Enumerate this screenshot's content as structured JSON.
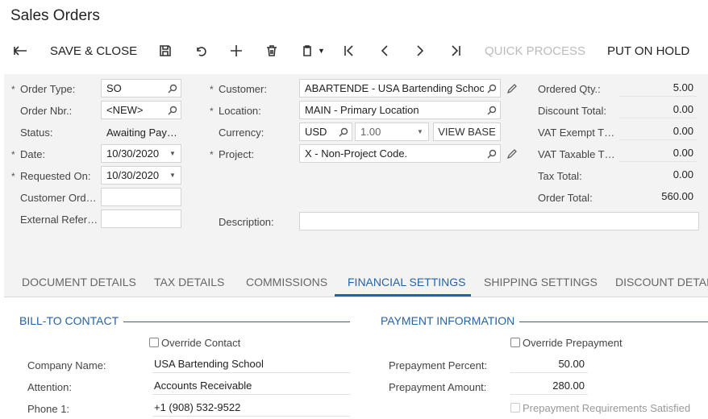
{
  "page": {
    "title": "Sales Orders"
  },
  "toolbar": {
    "back_icon": "back-arrow-icon",
    "save_close_label": "SAVE & CLOSE",
    "quick_process_label": "QUICK PROCESS",
    "put_on_hold_label": "PUT ON HOLD"
  },
  "form": {
    "order_type": {
      "label": "Order Type:",
      "value": "SO"
    },
    "order_nbr": {
      "label": "Order Nbr.:",
      "value": "<NEW>"
    },
    "status": {
      "label": "Status:",
      "value": "Awaiting Pay…"
    },
    "date": {
      "label": "Date:",
      "value": "10/30/2020"
    },
    "requested_on": {
      "label": "Requested On:",
      "value": "10/30/2020"
    },
    "customer_ord": {
      "label": "Customer Ord…",
      "value": ""
    },
    "external_ref": {
      "label": "External Refer…",
      "value": ""
    },
    "customer": {
      "label": "Customer:",
      "value": "ABARTENDE - USA Bartending Schoo"
    },
    "location": {
      "label": "Location:",
      "value": "MAIN - Primary Location"
    },
    "currency": {
      "label": "Currency:",
      "value": "USD",
      "rate": "1.00",
      "view_base_label": "VIEW BASE"
    },
    "project": {
      "label": "Project:",
      "value": "X - Non-Project Code."
    },
    "description": {
      "label": "Description:",
      "value": ""
    },
    "ordered_qty": {
      "label": "Ordered Qty.:",
      "value": "5.00"
    },
    "discount_total": {
      "label": "Discount Total:",
      "value": "0.00"
    },
    "vat_exempt": {
      "label": "VAT Exempt T…",
      "value": "0.00"
    },
    "vat_taxable": {
      "label": "VAT Taxable T…",
      "value": "0.00"
    },
    "tax_total": {
      "label": "Tax Total:",
      "value": "0.00"
    },
    "order_total": {
      "label": "Order Total:",
      "value": "560.00"
    }
  },
  "tabs": [
    {
      "label": "DOCUMENT DETAILS"
    },
    {
      "label": "TAX DETAILS"
    },
    {
      "label": "COMMISSIONS"
    },
    {
      "label": "FINANCIAL SETTINGS"
    },
    {
      "label": "SHIPPING SETTINGS"
    },
    {
      "label": "DISCOUNT DETAIL"
    }
  ],
  "active_tab": "FINANCIAL SETTINGS",
  "bill_to": {
    "title": "BILL-TO CONTACT",
    "override_label": "Override Contact",
    "company_name": {
      "label": "Company Name:",
      "value": "USA Bartending School"
    },
    "attention": {
      "label": "Attention:",
      "value": "Accounts Receivable"
    },
    "phone1": {
      "label": "Phone 1:",
      "value": "+1 (908) 532-9522"
    }
  },
  "payment": {
    "title": "PAYMENT INFORMATION",
    "override_label": "Override Prepayment",
    "prepay_percent": {
      "label": "Prepayment Percent:",
      "value": "50.00"
    },
    "prepay_amount": {
      "label": "Prepayment Amount:",
      "value": "280.00"
    },
    "requirements_label": "Prepayment Requirements Satisfied"
  },
  "colors": {
    "accent": "#2463a8",
    "form_bg": "#f3f3f3"
  }
}
